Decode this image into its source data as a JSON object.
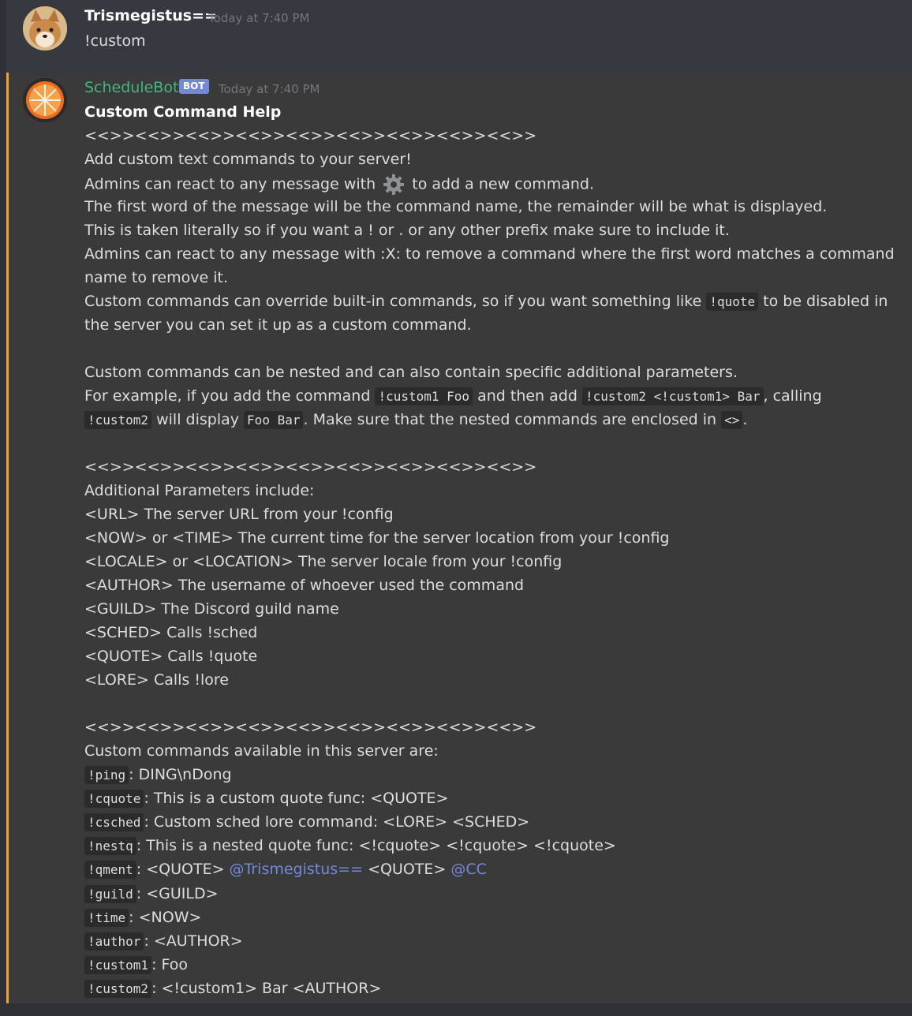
{
  "message1": {
    "username": "Trismegistus==",
    "timestamp": "Today at 7:40 PM",
    "content": "!custom"
  },
  "message2": {
    "username": "ScheduleBot",
    "bot_tag": "BOT",
    "timestamp": "Today at 7:40 PM",
    "title": "Custom Command Help",
    "separator": "<<>><<>><<>><<>><<>><<>><<>><<>><<>>",
    "line1": "Add custom text commands to your server!",
    "line2a": "Admins can react to any message with",
    "line2b": "to add a new command.",
    "line3": "The first word of the message will be the command name, the remainder will be what is displayed.",
    "line4": "This is taken literally so if you want a ! or . or any other prefix make sure to include it.",
    "line5a": "Admins can react to any message with :X: to remove a command where the first word matches a command",
    "line5b": "name to remove it.",
    "line6a": "Custom commands can override built-in commands, so if you want something like",
    "line6code": "!quote",
    "line6b": "to be disabled in",
    "line6c": "the server you can set it up as a custom command.",
    "line7": "Custom commands can be nested and can also contain specific additional parameters.",
    "line8a": "For example, if you add the command",
    "line8code1": "!custom1 Foo",
    "line8b": "and then add",
    "line8code2": "!custom2 <!custom1> Bar",
    "line8c": ", calling",
    "line9code1": "!custom2",
    "line9a": "will display",
    "line9code2": "Foo Bar",
    "line9b": ". Make sure that the nested commands are enclosed in",
    "line9code3": "<>",
    "line9c": ".",
    "params_header": "Additional Parameters include:",
    "params": [
      "<URL> The server URL from your !config",
      "<NOW> or <TIME> The current time for the server location from your !config",
      "<LOCALE> or <LOCATION> The server locale from your !config",
      "<AUTHOR> The username of whoever used the command",
      "<GUILD> The Discord guild name",
      "<SCHED> Calls !sched",
      "<QUOTE> Calls !quote",
      "<LORE> Calls !lore"
    ],
    "commands_header": "Custom commands available in this server are:",
    "commands": [
      {
        "name": "!ping",
        "desc": ": DING\\nDong"
      },
      {
        "name": "!cquote",
        "desc": ": This is a custom quote func: <QUOTE>"
      },
      {
        "name": "!csched",
        "desc": ": Custom sched lore command: <LORE> <SCHED>"
      },
      {
        "name": "!nestq",
        "desc": ": This is a nested quote func: <!cquote> <!cquote> <!cquote>"
      },
      {
        "name": "!qment",
        "desc_a": ": <QUOTE> ",
        "mention1": "@Trismegistus==",
        "desc_b": " <QUOTE> ",
        "mention2": "@CC"
      },
      {
        "name": "!guild",
        "desc": ": <GUILD>"
      },
      {
        "name": "!time",
        "desc": ": <NOW>"
      },
      {
        "name": "!author",
        "desc": ": <AUTHOR>"
      },
      {
        "name": "!custom1",
        "desc": ": Foo"
      },
      {
        "name": "!custom2",
        "desc": ": <!custom1> Bar <AUTHOR>"
      }
    ]
  },
  "colors": {
    "background": "#36393f",
    "bot_name": "#43b581",
    "bot_tag": "#7289da",
    "accent_bar": "#f0a232",
    "mention": "#7289da"
  }
}
